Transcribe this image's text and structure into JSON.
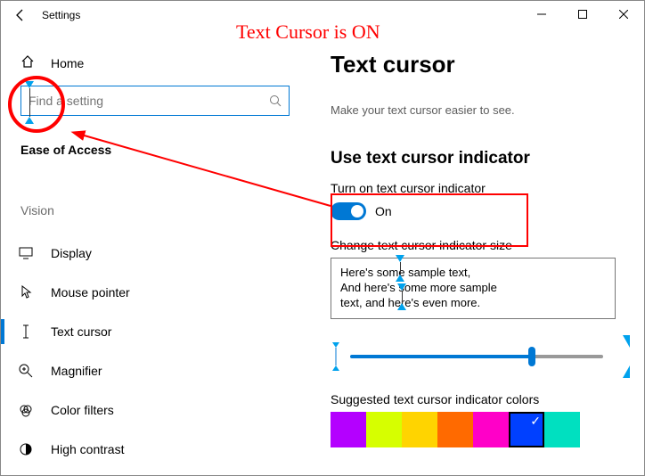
{
  "window": {
    "title": "Settings"
  },
  "sidebar": {
    "home": "Home",
    "search_placeholder": "Find a setting",
    "group": "Ease of Access",
    "subgroup": "Vision",
    "items": [
      {
        "label": "Display"
      },
      {
        "label": "Mouse pointer"
      },
      {
        "label": "Text cursor",
        "selected": true
      },
      {
        "label": "Magnifier"
      },
      {
        "label": "Color filters"
      },
      {
        "label": "High contrast"
      }
    ]
  },
  "main": {
    "title": "Text cursor",
    "subtitle": "Make your text cursor easier to see.",
    "section": {
      "heading": "Use text cursor indicator",
      "toggle_label": "Turn on text cursor indicator",
      "toggle_state": "On",
      "toggle_on": true,
      "size_label": "Change text cursor indicator size",
      "sample": [
        "Here's some sample text,",
        "And here's some more sample",
        "text, and here's even more."
      ],
      "slider_value_pct": 72,
      "colors_label": "Suggested text cursor indicator colors",
      "colors": [
        "#b400ff",
        "#d6ff00",
        "#ffd400",
        "#ff6a00",
        "#ff00c8",
        "#0040ff",
        "#00e0c0"
      ],
      "selected_color_index": 5
    }
  },
  "annotations": {
    "title": "Text Cursor is ON"
  }
}
